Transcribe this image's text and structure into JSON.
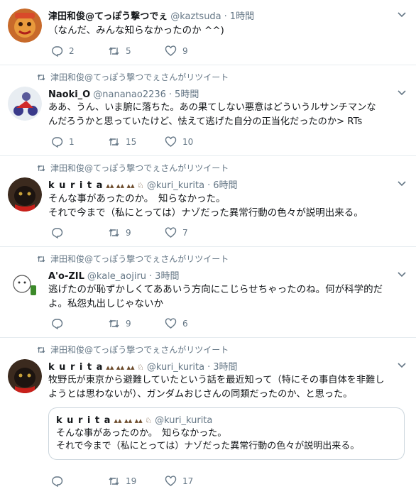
{
  "tweets": [
    {
      "retweet_label": "",
      "name": "津田和俊@てっぽう撃つでぇ",
      "handle": "@kaztsuda",
      "time": "1時間",
      "text": [
        "（なんだ、みんな知らなかったのか ^^)"
      ],
      "replies": "2",
      "retweets": "5",
      "likes": "9"
    },
    {
      "retweet_label": "津田和俊@てっぽう撃つでぇさんがリツイート",
      "name": "Naoki_O",
      "handle": "@nananao2236",
      "time": "5時間",
      "text": [
        "ああ、うん、いま腑に落ちた。あの果てしない悪意はどういうルサンチマンな",
        "んだろうかと思っていたけど、怯えて逃げた自分の正当化だったのか> RTs"
      ],
      "replies": "1",
      "retweets": "15",
      "likes": "10"
    },
    {
      "retweet_label": "津田和俊@てっぽう撃つでぇさんがリツイート",
      "name": "k u r i t a",
      "handle": "@kuri_kurita",
      "time": "6時間",
      "text": [
        "そんな事があったのか。　知らなかった。",
        "それで今まで（私にとっては）ナゾだった異常行動の色々が説明出来る。"
      ],
      "replies": "",
      "retweets": "9",
      "likes": "7"
    },
    {
      "retweet_label": "津田和俊@てっぽう撃つでぇさんがリツイート",
      "name": "A'o-ZIL",
      "handle": "@kale_aojiru",
      "time": "3時間",
      "text": [
        "逃げたのが恥ずかしくてああいう方向にこじらせちゃったのね。何が科学的だ",
        "よ。私怨丸出しじゃないか"
      ],
      "replies": "",
      "retweets": "9",
      "likes": "6"
    },
    {
      "retweet_label": "津田和俊@てっぽう撃つでぇさんがリツイート",
      "name": "k u r i t a",
      "handle": "@kuri_kurita",
      "time": "3時間",
      "text": [
        "牧野氏が東京から避難していたという話を最近知って（特にその事自体を非難し",
        "ようとは思わないが）、ガンダムおじさんの同類だったのか、と思った。"
      ],
      "quote": {
        "name": "k u r i t a",
        "handle": "@kuri_kurita",
        "text": [
          "そんな事があったのか。　知らなかった。",
          "それで今まで（私にとっては）ナゾだった異常行動の色々が説明出来る。"
        ]
      },
      "replies": "",
      "retweets": "19",
      "likes": "17"
    }
  ],
  "colors": {
    "muted": "#657786",
    "text": "#14171a",
    "border": "#e6ecf0"
  },
  "icons": [
    "reply-icon",
    "retweet-icon",
    "like-icon",
    "chevron-down-icon"
  ]
}
